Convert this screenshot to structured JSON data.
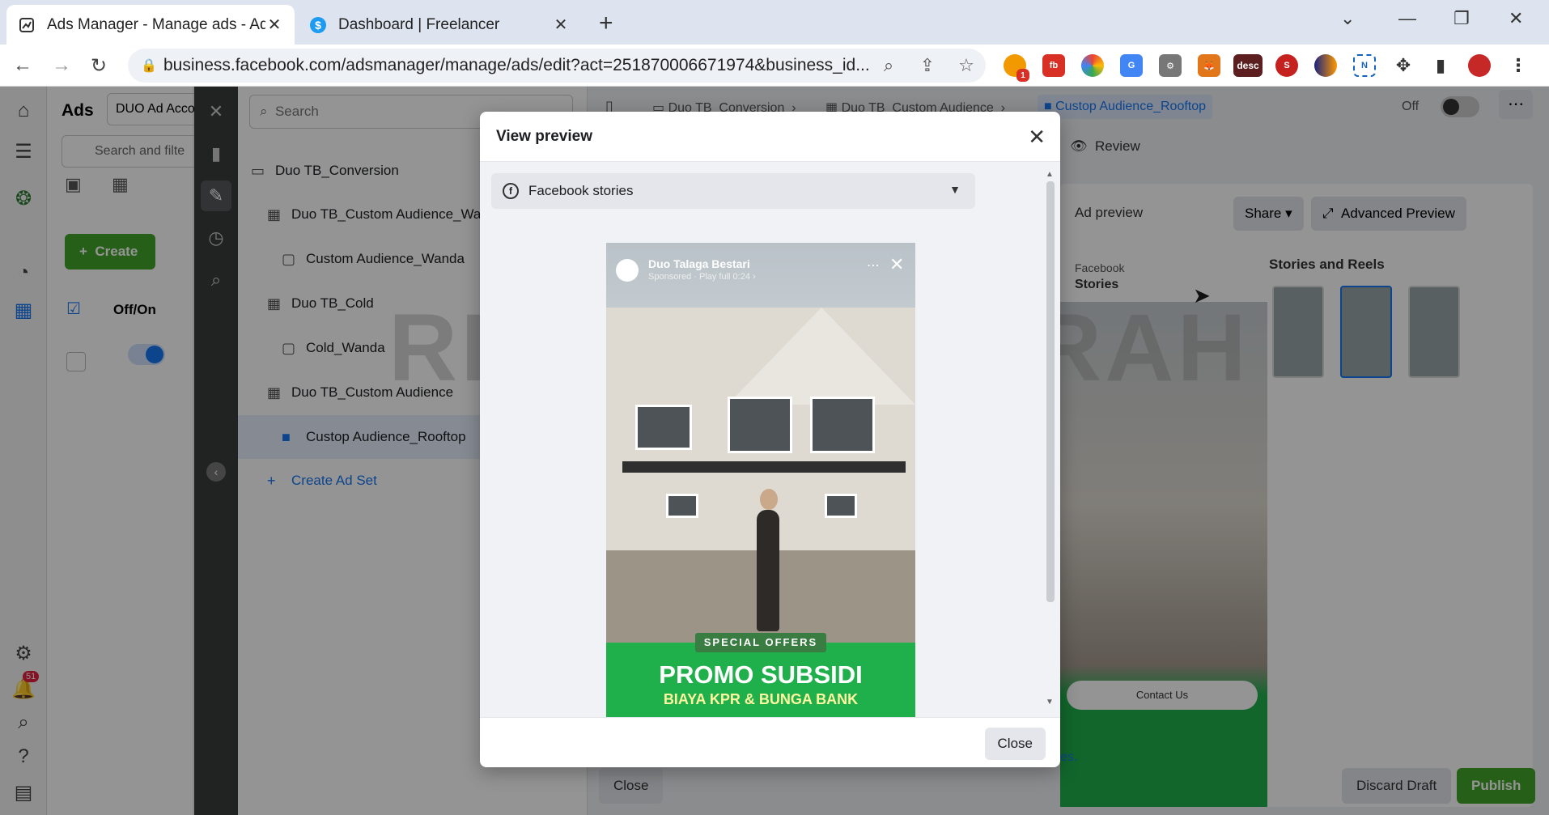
{
  "browser": {
    "tabs": [
      {
        "title": "Ads Manager - Manage ads - Ad",
        "active": true
      },
      {
        "title": "Dashboard | Freelancer",
        "active": false
      }
    ],
    "url": "business.facebook.com/adsmanager/manage/ads/edit?act=251870006671974&business_id...",
    "extensions": [
      "ext-1",
      "ext-2",
      "ext-3",
      "ext-4",
      "ext-5",
      "ext-6",
      "desc",
      "ext-8",
      "ext-9",
      "N",
      "puzzle",
      "sidebar",
      "profile"
    ],
    "extension_badge": "1",
    "extension_desc_label": "desc"
  },
  "leftrail": {
    "notification_count": "51"
  },
  "ads_panel": {
    "title": "Ads",
    "account": "DUO Ad Acco",
    "search_placeholder": "Search and filte",
    "create_label": "Create",
    "col_offon": "Off/On"
  },
  "tree": {
    "search_placeholder": "Search",
    "items": [
      {
        "label": "Duo TB_Conversion",
        "type": "campaign",
        "indent": 0
      },
      {
        "label": "Duo TB_Custom Audience_Wan",
        "type": "adset",
        "indent": 1
      },
      {
        "label": "Custom Audience_Wanda",
        "type": "ad",
        "indent": 2
      },
      {
        "label": "Duo TB_Cold",
        "type": "adset",
        "indent": 1
      },
      {
        "label": "Cold_Wanda",
        "type": "ad",
        "indent": 2
      },
      {
        "label": "Duo TB_Custom Audience",
        "type": "adset",
        "indent": 1
      },
      {
        "label": "Custop Audience_Rooftop",
        "type": "ad",
        "indent": 2,
        "selected": true
      }
    ],
    "create_adset_label": "Create Ad Set"
  },
  "right_panel": {
    "breadcrumb": [
      "Duo TB_Conversion",
      "Duo TB_Custom Audience",
      "Custop Audience_Rooftop"
    ],
    "toggle_label": "Off",
    "review_label": "Review",
    "ad_preview_label": "Ad preview",
    "share_label": "Share",
    "advanced_preview_label": "Advanced Preview",
    "placement_group": "Facebook",
    "placement_name": "Stories",
    "stories_reels_label": "Stories and Reels",
    "contact_cta": "Contact Us",
    "note_text": "es.",
    "close_label": "Close",
    "discard_label": "Discard Draft",
    "publish_label": "Publish"
  },
  "watermark": "RIDHO ANUGRAH",
  "modal": {
    "title": "View preview",
    "placement_select": "Facebook stories",
    "close_button": "Close",
    "story": {
      "page_name": "Duo Talaga Bestari",
      "meta": "Sponsored · Play full 0:24 ›",
      "special_offers": "SPECIAL OFFERS",
      "promo_title": "PROMO SUBSIDI",
      "promo_subtitle": "BIAYA KPR & BUNGA BANK"
    }
  },
  "colors": {
    "create_green": "#42a429",
    "fb_blue": "#1877f2",
    "promo_green": "#1fb04c",
    "dark_rail": "#3a3b3c"
  }
}
